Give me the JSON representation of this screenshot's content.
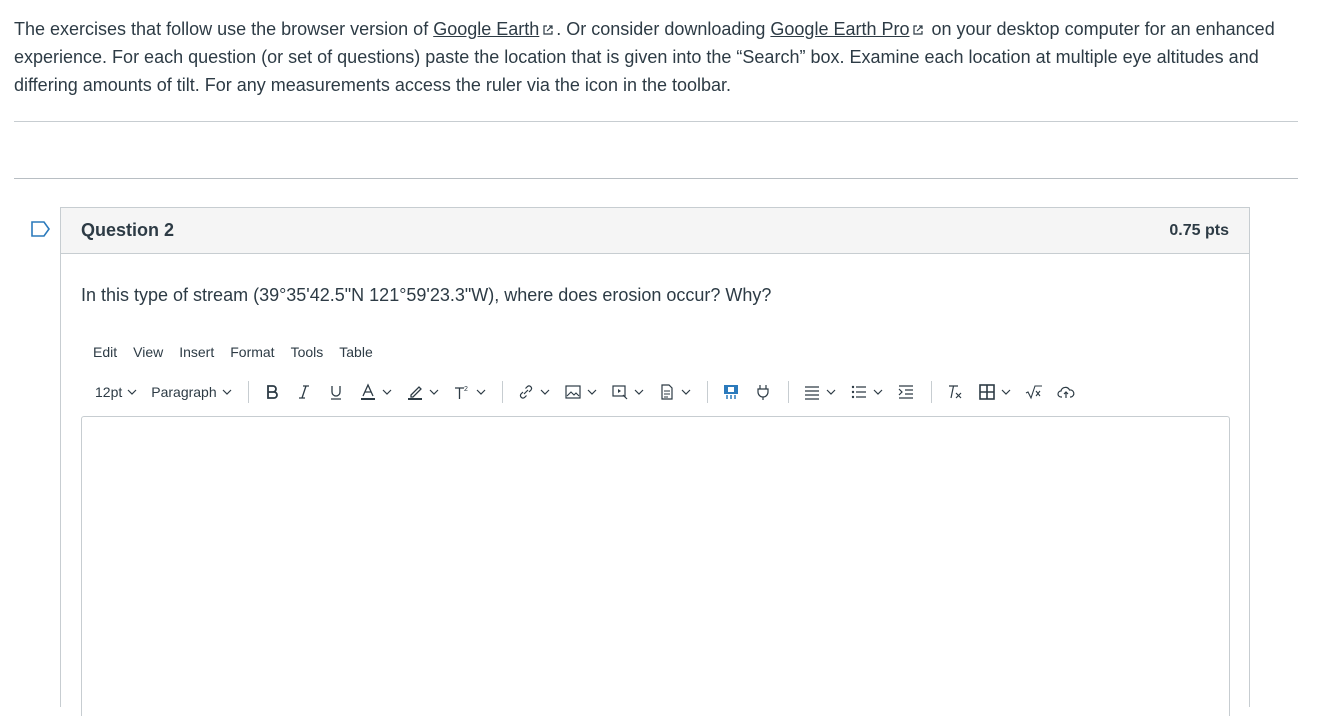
{
  "intro": {
    "part1": "The exercises that follow use the browser version of ",
    "link1": "Google Earth",
    "part2": ". Or consider downloading ",
    "link2": "Google Earth Pro",
    "part3": " on your desktop computer for an enhanced experience. For each question (or set of questions) paste the location that is given into the “Search” box. Examine each location at multiple eye altitudes and differing amounts of tilt. For any measurements access the ruler via the icon in the toolbar."
  },
  "question": {
    "title": "Question 2",
    "points": "0.75 pts",
    "text": "In this type of stream (39°35'42.5\"N 121°59'23.3\"W), where does erosion occur? Why?"
  },
  "editor": {
    "menu": [
      "Edit",
      "View",
      "Insert",
      "Format",
      "Tools",
      "Table"
    ],
    "font_size": "12pt",
    "block_format": "Paragraph",
    "icons": [
      "bold-icon",
      "italic-icon",
      "underline-icon",
      "text-color-icon",
      "highlight-icon",
      "superscript-icon",
      "link-icon",
      "image-icon",
      "media-icon",
      "document-icon",
      "apps-icon",
      "plugin-icon",
      "align-icon",
      "list-icon",
      "indent-icon",
      "clear-formatting-icon",
      "table-icon",
      "equation-icon",
      "upload-cloud-icon"
    ]
  },
  "colors": {
    "text": "#2d3b45",
    "border": "#c7cdd1",
    "header_bg": "#f5f5f5",
    "accent": "#2b7abc"
  }
}
